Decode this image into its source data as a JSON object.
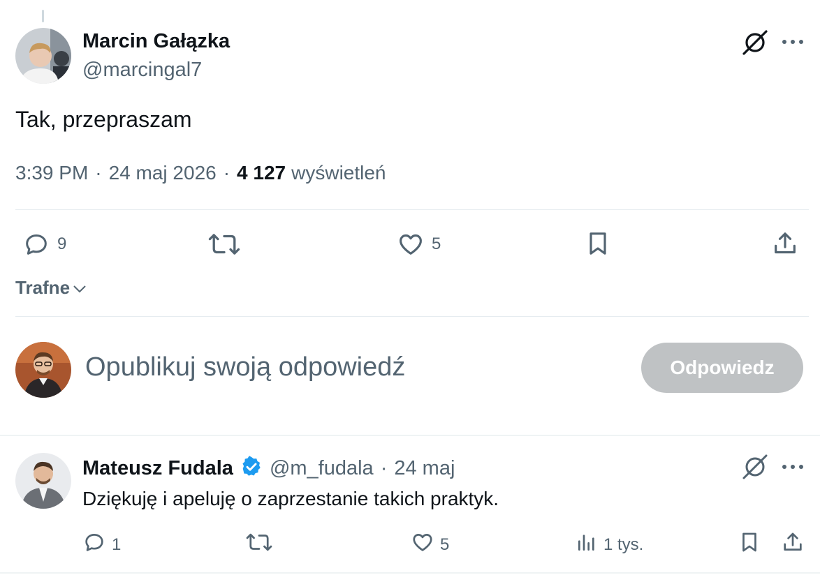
{
  "main_post": {
    "author_name": "Marcin Gałązka",
    "author_handle": "@marcingal7",
    "text": "Tak, przepraszam",
    "time": "3:39 PM",
    "date": "24 maj 2026",
    "views_count": "4 127",
    "views_label": "wyświetleń",
    "separator": "·",
    "actions": {
      "replies": "9",
      "likes": "5"
    }
  },
  "sort": {
    "label": "Trafne"
  },
  "compose": {
    "placeholder": "Opublikuj swoją odpowiedź",
    "button_label": "Odpowiedz"
  },
  "reply": {
    "author_name": "Mateusz Fudala",
    "author_handle": "@m_fudala",
    "date": "24 maj",
    "separator": "·",
    "text": "Dziękuję i apeluję o zaprzestanie takich praktyk.",
    "actions": {
      "replies": "1",
      "likes": "5",
      "views": "1 tys."
    }
  },
  "colors": {
    "verified_badge": "#1d9bf0",
    "secondary_text": "#536471",
    "disabled_button": "#bfc2c4"
  },
  "icons": [
    "grok-icon",
    "more-icon",
    "reply-icon",
    "retweet-icon",
    "like-icon",
    "bookmark-icon",
    "share-icon",
    "views-icon",
    "verified-icon",
    "chevron-down-icon"
  ]
}
